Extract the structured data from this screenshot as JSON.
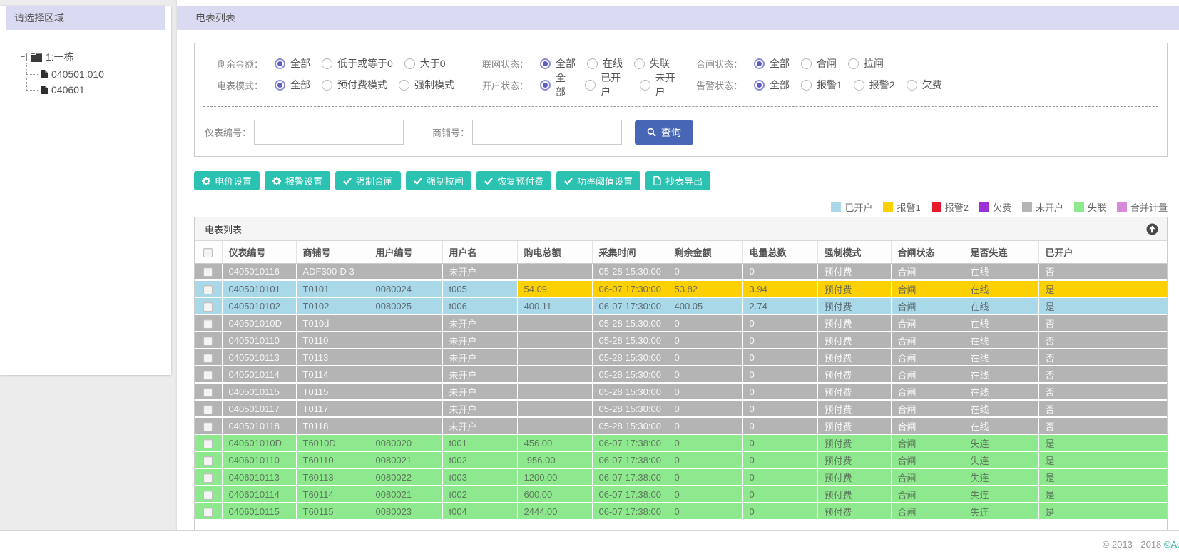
{
  "sidebar": {
    "title": "请选择区域",
    "tree": {
      "root": "1:一栋",
      "children": [
        "040501:010",
        "040601"
      ]
    }
  },
  "header": {
    "title": "电表列表"
  },
  "filters": {
    "groups": [
      {
        "label": "剩余金额：",
        "options": [
          "全部",
          "低于或等于0",
          "大于0"
        ],
        "selected": 0
      },
      {
        "label": "联网状态：",
        "options": [
          "全部",
          "在线",
          "失联"
        ],
        "selected": 0
      },
      {
        "label": "合闸状态：",
        "options": [
          "全部",
          "合闸",
          "拉闸"
        ],
        "selected": 0
      },
      {
        "label": "电表模式：",
        "options": [
          "全部",
          "预付费模式",
          "强制模式"
        ],
        "selected": 0
      },
      {
        "label": "开户状态：",
        "options": [
          "全部",
          "已开户",
          "未开户"
        ],
        "selected": 0
      },
      {
        "label": "告警状态：",
        "options": [
          "全部",
          "报警1",
          "报警2",
          "欠费"
        ],
        "selected": 0
      }
    ],
    "search": {
      "meter_label": "仪表编号：",
      "meter_value": "",
      "shop_label": "商铺号：",
      "shop_value": "",
      "button": "查询"
    }
  },
  "toolbar": {
    "buttons": [
      {
        "id": "price-settings",
        "icon": "gear",
        "label": "电价设置"
      },
      {
        "id": "alarm-settings",
        "icon": "gear",
        "label": "报警设置"
      },
      {
        "id": "force-close",
        "icon": "check",
        "label": "强制合闸"
      },
      {
        "id": "force-trip",
        "icon": "check",
        "label": "强制拉闸"
      },
      {
        "id": "restore-prepaid",
        "icon": "check",
        "label": "恢复预付费"
      },
      {
        "id": "power-threshold",
        "icon": "check",
        "label": "功率阈值设置"
      },
      {
        "id": "meter-export",
        "icon": "doc",
        "label": "抄表导出"
      }
    ]
  },
  "legend": [
    {
      "label": "已开户",
      "color": "#a9d8e8"
    },
    {
      "label": "报警1",
      "color": "#fdd101"
    },
    {
      "label": "报警2",
      "color": "#e8192c"
    },
    {
      "label": "欠费",
      "color": "#9a30d5"
    },
    {
      "label": "未开户",
      "color": "#b4b4b4"
    },
    {
      "label": "失联",
      "color": "#8ee88e"
    },
    {
      "label": "合并计量",
      "color": "#d78ad7"
    }
  ],
  "table": {
    "panel_title": "电表列表",
    "columns": [
      "仪表编号",
      "商铺号",
      "用户编号",
      "用户名",
      "购电总额",
      "采集时间",
      "剩余金额",
      "电量总数",
      "强制模式",
      "合闸状态",
      "是否失连",
      "已开户"
    ],
    "rows": [
      {
        "state": "unopened",
        "cells": [
          "0405010116",
          "ADF300-D 3",
          "",
          "未开户",
          "",
          "05-28 15:30:00",
          "0",
          "0",
          "预付费",
          "合闸",
          "在线",
          "否"
        ]
      },
      {
        "state": "opened_alarm1",
        "cells": [
          "0405010101",
          "T0101",
          "0080024",
          "t005",
          "54.09",
          "06-07 17:30:00",
          "53.82",
          "3.94",
          "预付费",
          "合闸",
          "在线",
          "是"
        ]
      },
      {
        "state": "opened",
        "cells": [
          "0405010102",
          "T0102",
          "0080025",
          "t006",
          "400.11",
          "06-07 17:30:00",
          "400.05",
          "2.74",
          "预付费",
          "合闸",
          "在线",
          "是"
        ]
      },
      {
        "state": "unopened",
        "cells": [
          "040501010D",
          "T010d",
          "",
          "未开户",
          "",
          "05-28 15:30:00",
          "0",
          "0",
          "预付费",
          "合闸",
          "在线",
          "否"
        ]
      },
      {
        "state": "unopened",
        "cells": [
          "0405010110",
          "T0110",
          "",
          "未开户",
          "",
          "05-28 15:30:00",
          "0",
          "0",
          "预付费",
          "合闸",
          "在线",
          "否"
        ]
      },
      {
        "state": "unopened",
        "cells": [
          "0405010113",
          "T0113",
          "",
          "未开户",
          "",
          "05-28 15:30:00",
          "0",
          "0",
          "预付费",
          "合闸",
          "在线",
          "否"
        ]
      },
      {
        "state": "unopened",
        "cells": [
          "0405010114",
          "T0114",
          "",
          "未开户",
          "",
          "05-28 15:30:00",
          "0",
          "0",
          "预付费",
          "合闸",
          "在线",
          "否"
        ]
      },
      {
        "state": "unopened",
        "cells": [
          "0405010115",
          "T0115",
          "",
          "未开户",
          "",
          "05-28 15:30:00",
          "0",
          "0",
          "预付费",
          "合闸",
          "在线",
          "否"
        ]
      },
      {
        "state": "unopened",
        "cells": [
          "0405010117",
          "T0117",
          "",
          "未开户",
          "",
          "05-28 15:30:00",
          "0",
          "0",
          "预付费",
          "合闸",
          "在线",
          "否"
        ]
      },
      {
        "state": "unopened",
        "cells": [
          "0405010118",
          "T0118",
          "",
          "未开户",
          "",
          "05-28 15:30:00",
          "0",
          "0",
          "预付费",
          "合闸",
          "在线",
          "否"
        ]
      },
      {
        "state": "disconnected",
        "cells": [
          "040601010D",
          "T6010D",
          "0080020",
          "t001",
          "456.00",
          "06-07 17:38:00",
          "0",
          "0",
          "预付费",
          "合闸",
          "失连",
          "是"
        ]
      },
      {
        "state": "disconnected",
        "cells": [
          "0406010110",
          "T60110",
          "0080021",
          "t002",
          "-956.00",
          "06-07 17:38:00",
          "0",
          "0",
          "预付费",
          "合闸",
          "失连",
          "是"
        ]
      },
      {
        "state": "disconnected",
        "cells": [
          "0406010113",
          "T60113",
          "0080022",
          "t003",
          "1200.00",
          "06-07 17:38:00",
          "0",
          "0",
          "预付费",
          "合闸",
          "失连",
          "是"
        ]
      },
      {
        "state": "disconnected",
        "cells": [
          "0406010114",
          "T60114",
          "0080021",
          "t002",
          "600.00",
          "06-07 17:38:00",
          "0",
          "0",
          "预付费",
          "合闸",
          "失连",
          "是"
        ]
      },
      {
        "state": "disconnected",
        "cells": [
          "0406010115",
          "T60115",
          "0080023",
          "t004",
          "2444.00",
          "06-07 17:38:00",
          "0",
          "0",
          "预付费",
          "合闸",
          "失连",
          "是"
        ]
      }
    ]
  },
  "footer": {
    "copyright_gray": "© 2013 - 2018 ",
    "copyright_teal": "©Acr"
  },
  "colors": {
    "accent_teal": "#2bc2b1",
    "accent_blue": "#4767b6",
    "header_lavender": "#dadaf2",
    "radio_purple": "#6a6ac8"
  }
}
